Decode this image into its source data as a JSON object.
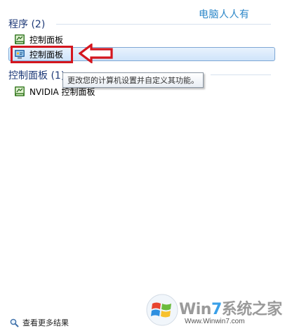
{
  "watermark_top": "电脑人人有",
  "groups": [
    {
      "header": "程序 (2)",
      "items": [
        {
          "label": "控制面板",
          "icon": "control-panel-green-icon"
        },
        {
          "label": "控制面板",
          "icon": "control-panel-monitor-icon",
          "selected": true
        }
      ]
    },
    {
      "header": "控制面板 (1)",
      "items": [
        {
          "label": "NVIDIA 控制面板",
          "icon": "nvidia-control-panel-icon"
        }
      ]
    }
  ],
  "tooltip": "更改您的计算机设置并自定义其功能。",
  "see_more": "查看更多结果",
  "brand": {
    "prefix": "Win",
    "seven": "7",
    "suffix": "系统之家",
    "url": "Www.Winwin7.com"
  },
  "colors": {
    "highlight_border": "#7ea7d4",
    "annotation_red": "#d4161e",
    "header_blue": "#1e3a78"
  }
}
